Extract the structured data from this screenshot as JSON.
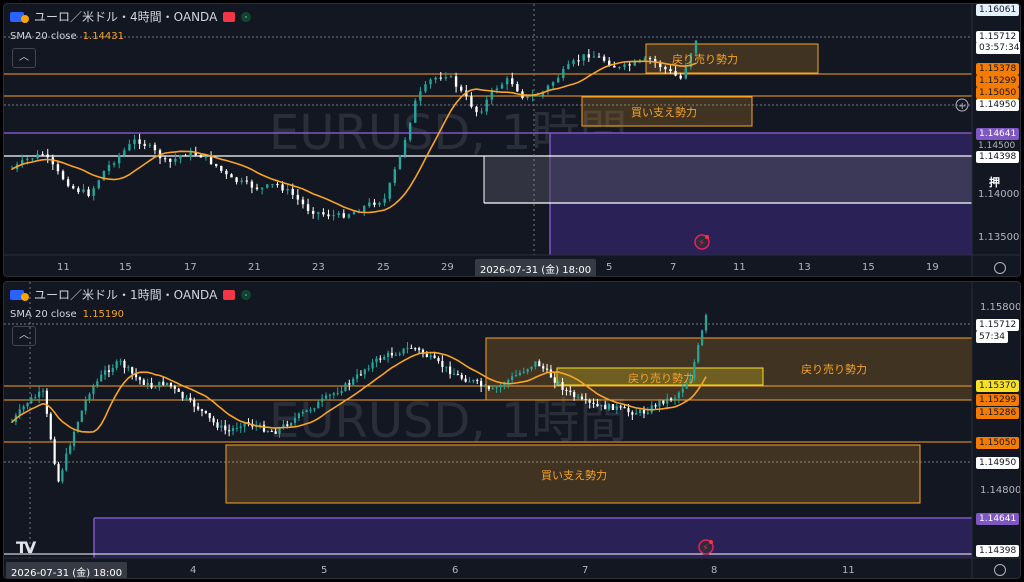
{
  "panels": [
    {
      "id": "4h",
      "title": "ユーロ／米ドル・4時間・OANDA",
      "sma_label": "SMA 20 close",
      "sma_value": "1.14431",
      "watermark": "EURUSD, 1時間",
      "price_labels": [
        "1.16061",
        "1.15712",
        "03:57:34",
        "1.15378",
        "1.15299",
        "1.15050",
        "1.14950",
        "1.14641",
        "1.14500",
        "1.14398",
        "1.14000",
        "1.13500"
      ],
      "x_labels": [
        "11",
        "15",
        "17",
        "21",
        "23",
        "25",
        "29",
        "5",
        "7",
        "11",
        "13",
        "15",
        "19"
      ],
      "crosshair_time": "2026-07-31 (金)   18:00",
      "boxes": [
        "戻り売り勢力",
        "買い支え勢力"
      ],
      "edge_text": "押"
    },
    {
      "id": "1h",
      "title": "ユーロ／米ドル・1時間・OANDA",
      "sma_label": "SMA 20 close",
      "sma_value": "1.15190",
      "watermark": "EURUSD, 1時間",
      "price_labels": [
        "1.15800",
        "1.15712",
        "57:34",
        "1.15370",
        "1.15299",
        "1.15286",
        "1.15050",
        "1.14950",
        "1.14800",
        "1.14641",
        "1.14398"
      ],
      "x_labels": [
        "4",
        "5",
        "6",
        "7",
        "8",
        "11"
      ],
      "crosshair_time": "2026-07-31 (金)   18:00",
      "boxes": [
        "戻り売り勢力",
        "戻り売り勢力",
        "買い支え勢力"
      ]
    }
  ],
  "colors": {
    "bg": "#131722",
    "up": "#26a69a",
    "down": "#ffffff",
    "sma": "#f7a325",
    "zone_orange": "#f7a325",
    "zone_purple": "#7e57c2"
  },
  "icons": [
    "flag-icon",
    "close-square-icon",
    "live-dot-icon",
    "collapse-icon",
    "gear-icon",
    "lightning-icon",
    "plus-circle-icon",
    "tradingview-logo-icon"
  ]
}
